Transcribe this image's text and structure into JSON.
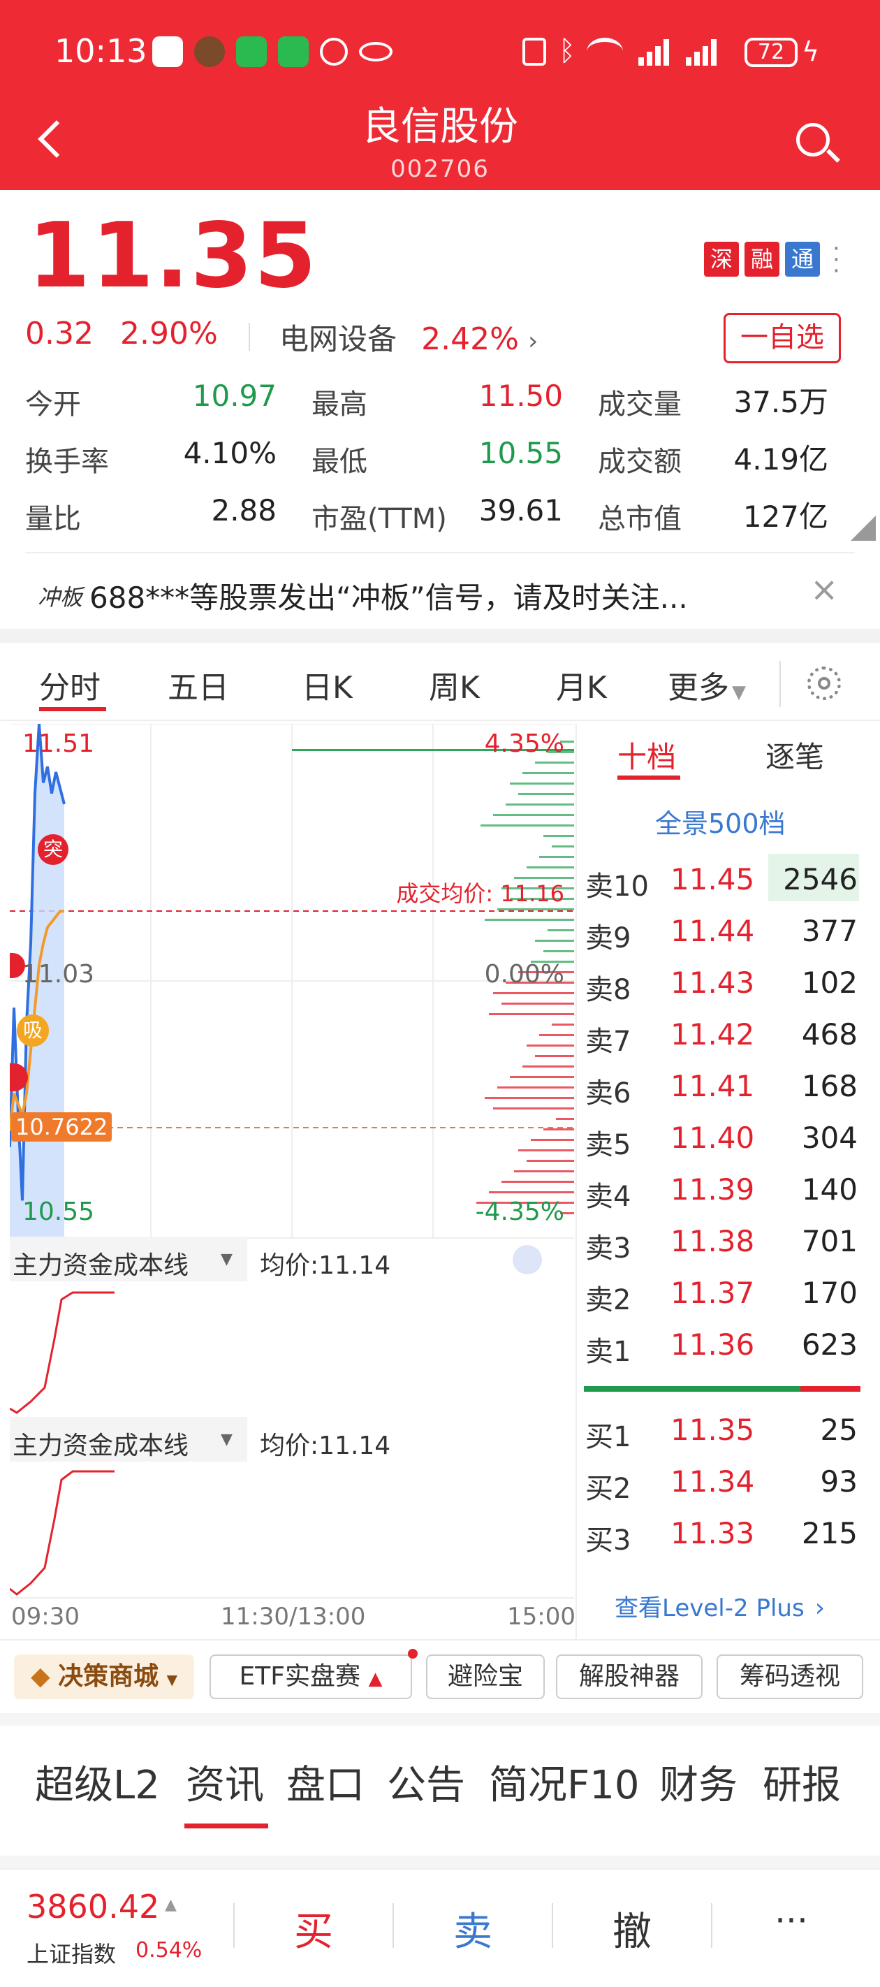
{
  "status_bar": {
    "time": "10:13",
    "battery": "72"
  },
  "header": {
    "title": "良信股份",
    "code": "002706"
  },
  "quote": {
    "price": "11.35",
    "change": "0.32",
    "change_pct": "2.90%",
    "sector": "电网设备",
    "sector_pct": "2.42%",
    "badges": [
      "深",
      "融",
      "通"
    ],
    "watch_button": "一自选",
    "stats": [
      {
        "label": "今开",
        "value": "10.97",
        "color": "green"
      },
      {
        "label": "最高",
        "value": "11.50",
        "color": "red"
      },
      {
        "label": "成交量",
        "value": "37.5万",
        "color": "dark"
      },
      {
        "label": "换手率",
        "value": "4.10%",
        "color": "dark"
      },
      {
        "label": "最低",
        "value": "10.55",
        "color": "green"
      },
      {
        "label": "成交额",
        "value": "4.19亿",
        "color": "dark"
      },
      {
        "label": "量比",
        "value": "2.88",
        "color": "dark"
      },
      {
        "label": "市盈(TTM)",
        "value": "39.61",
        "color": "dark"
      },
      {
        "label": "总市值",
        "value": "127亿",
        "color": "dark"
      }
    ]
  },
  "notice": {
    "tag": "冲板",
    "text": "688***等股票发出“冲板”信号，请及时关注..."
  },
  "chart_tabs": [
    "分时",
    "五日",
    "日K",
    "周K",
    "月K",
    "更多"
  ],
  "chart": {
    "high_label": "11.51",
    "mid_label": "11.03",
    "low_label": "10.55",
    "pct_top": "4.35%",
    "pct_mid": "0.00%",
    "pct_bottom": "-4.35%",
    "avg_price_label": "成交均价: 11.16",
    "current_marker": "10.7622",
    "marker_tu": "突",
    "marker_xi": "吸",
    "indicator1": {
      "name": "主力资金成本线",
      "avg": "均价:11.14"
    },
    "indicator2": {
      "name": "主力资金成本线",
      "avg": "均价:11.14"
    },
    "time_axis": [
      "09:30",
      "11:30/13:00",
      "15:00"
    ]
  },
  "chart_data": {
    "type": "line",
    "x": [
      "09:30",
      "09:31",
      "09:32",
      "09:33",
      "09:34",
      "09:35",
      "09:36",
      "09:37",
      "09:38",
      "09:39",
      "09:40",
      "09:41",
      "09:42",
      "09:43"
    ],
    "series": [
      {
        "values": [
          10.72,
          10.98,
          10.78,
          10.62,
          10.95,
          11.1,
          11.38,
          11.51,
          11.4,
          11.43,
          11.38,
          11.42,
          11.39,
          11.36
        ]
      },
      {
        "values": [
          10.75,
          10.82,
          10.8,
          10.78,
          10.82,
          10.9,
          10.98,
          11.06,
          11.1,
          11.13,
          11.14,
          11.15,
          11.16,
          11.16
        ]
      }
    ],
    "ylim": [
      10.55,
      11.51
    ],
    "ylabel_ticks": [
      "11.51",
      "11.03",
      "10.55"
    ]
  },
  "orderbook": {
    "tabs": [
      "十档",
      "逐笔"
    ],
    "panorama": "全景500档",
    "sells": [
      {
        "label": "卖10",
        "price": "11.45",
        "vol": "2546"
      },
      {
        "label": "卖9",
        "price": "11.44",
        "vol": "377"
      },
      {
        "label": "卖8",
        "price": "11.43",
        "vol": "102"
      },
      {
        "label": "卖7",
        "price": "11.42",
        "vol": "468"
      },
      {
        "label": "卖6",
        "price": "11.41",
        "vol": "168"
      },
      {
        "label": "卖5",
        "price": "11.40",
        "vol": "304"
      },
      {
        "label": "卖4",
        "price": "11.39",
        "vol": "140"
      },
      {
        "label": "卖3",
        "price": "11.38",
        "vol": "701"
      },
      {
        "label": "卖2",
        "price": "11.37",
        "vol": "170"
      },
      {
        "label": "卖1",
        "price": "11.36",
        "vol": "623"
      }
    ],
    "buys": [
      {
        "label": "买1",
        "price": "11.35",
        "vol": "25"
      },
      {
        "label": "买2",
        "price": "11.34",
        "vol": "93"
      },
      {
        "label": "买3",
        "price": "11.33",
        "vol": "215"
      }
    ],
    "level2_link": "查看Level-2 Plus"
  },
  "chips": [
    "决策商城",
    "ETF实盘赛",
    "避险宝",
    "解股神器",
    "筹码透视"
  ],
  "bottom_tabs": [
    "超级L2",
    "资讯",
    "盘口",
    "公告",
    "简况F10",
    "财务",
    "研报"
  ],
  "footer": {
    "index_value": "3860.42",
    "index_name": "上证指数",
    "index_pct": "0.54%",
    "buy": "买",
    "sell": "卖",
    "cancel": "撤",
    "more": "···"
  }
}
